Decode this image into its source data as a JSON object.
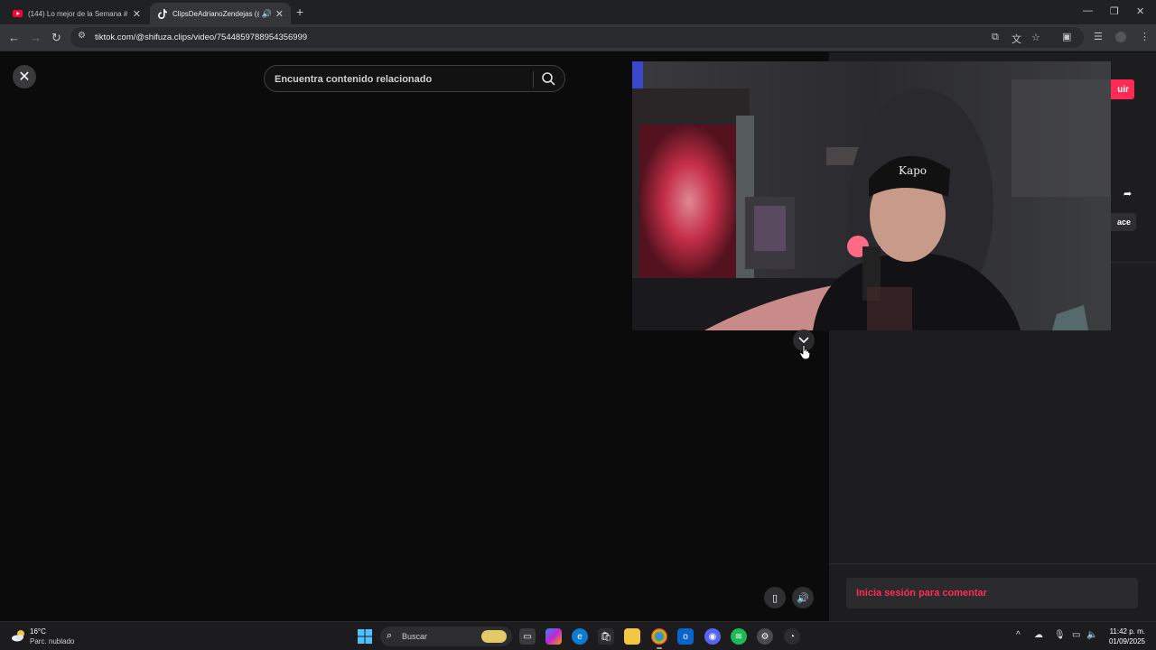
{
  "browser": {
    "tabs": [
      {
        "title": "(144) Lo mejor de la Semana #",
        "favicon": "youtube-icon",
        "active": false
      },
      {
        "title": "ClipsDeAdrianoZendejas (@",
        "favicon": "tiktok-icon",
        "active": true,
        "audio": true
      }
    ],
    "url": "tiktok.com/@shifuza.clips/video/7544859788954356999"
  },
  "page": {
    "search_placeholder": "Encuentra contenido relacionado",
    "follow_label_partial": "uir",
    "copy_link_partial": "ace",
    "comment_prompt": "Inicia sesión para comentar",
    "overlay_text": "Kapo",
    "accent_color": "#fe2c55"
  },
  "taskbar": {
    "temperature": "16°C",
    "condition": "Parc. nublado",
    "search_label": "Buscar",
    "time": "11:42 p. m.",
    "date": "01/09/2025"
  }
}
